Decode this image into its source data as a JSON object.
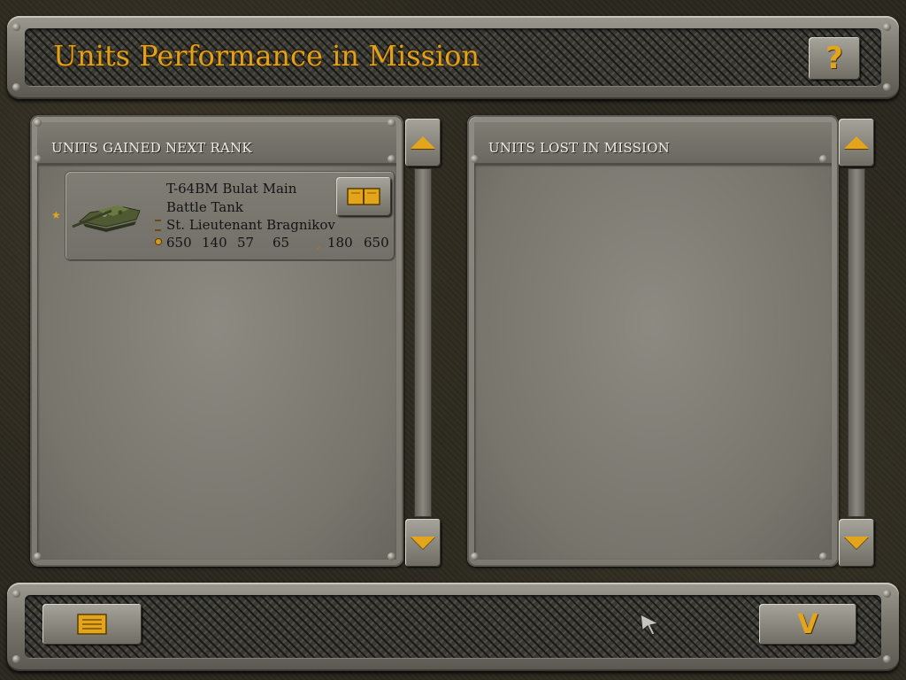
{
  "header": {
    "title": "Units Performance in Mission",
    "help_label": "?"
  },
  "left_panel": {
    "title": "UNITS GAINED NEXT RANK",
    "units": [
      {
        "name_line1": "T-64BM Bulat Main",
        "name_line2": "Battle Tank",
        "commander": "St. Lieutenant Bragnikov",
        "stats": [
          "650",
          "140",
          "57",
          "65",
          "180",
          "650"
        ]
      }
    ]
  },
  "right_panel": {
    "title": "UNITS LOST IN MISSION"
  },
  "footer": {
    "ok_label": "V"
  },
  "colors": {
    "accent": "#e2a51c",
    "title_gold": "#e0a020"
  }
}
